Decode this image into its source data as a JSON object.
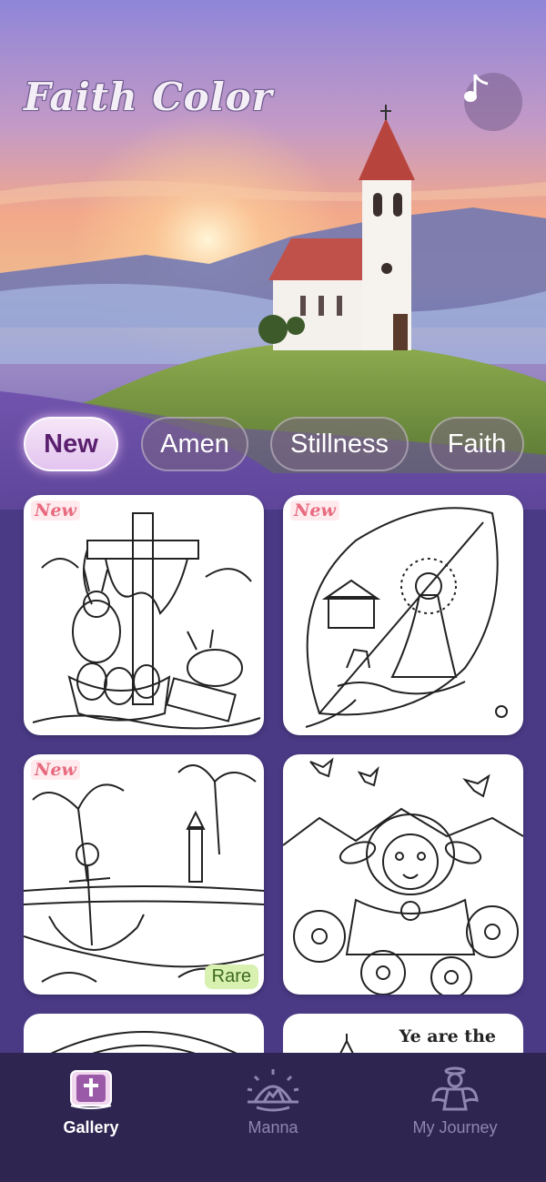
{
  "app": {
    "title": "Faith Color"
  },
  "header": {
    "music_icon": "music-note-icon"
  },
  "tabs": [
    {
      "label": "New",
      "active": true
    },
    {
      "label": "Amen",
      "active": false
    },
    {
      "label": "Stillness",
      "active": false
    },
    {
      "label": "Faith",
      "active": false
    }
  ],
  "gallery": {
    "items": [
      {
        "subject": "Cross with Easter bunnies and eggs",
        "badge": "New"
      },
      {
        "subject": "Jesus in leaf with deer",
        "badge": "New"
      },
      {
        "subject": "Anchor on tropical beach with lighthouse",
        "badge": "New",
        "tag": "Rare"
      },
      {
        "subject": "Lamb among daisies with butterflies",
        "badge": ""
      },
      {
        "subject": "Mandala",
        "badge": ""
      },
      {
        "subject": "Ye are the light",
        "text": "Ye are the"
      }
    ]
  },
  "nav": {
    "items": [
      {
        "label": "Gallery",
        "icon": "bible-book-icon",
        "active": true
      },
      {
        "label": "Manna",
        "icon": "sunrise-icon",
        "active": false
      },
      {
        "label": "My Journey",
        "icon": "angel-icon",
        "active": false
      }
    ]
  },
  "colors": {
    "accent": "#5a1f6e",
    "nav_bg": "#2e2550",
    "new_badge": "#e86a7e",
    "rare_badge": "#d8f0b0"
  }
}
